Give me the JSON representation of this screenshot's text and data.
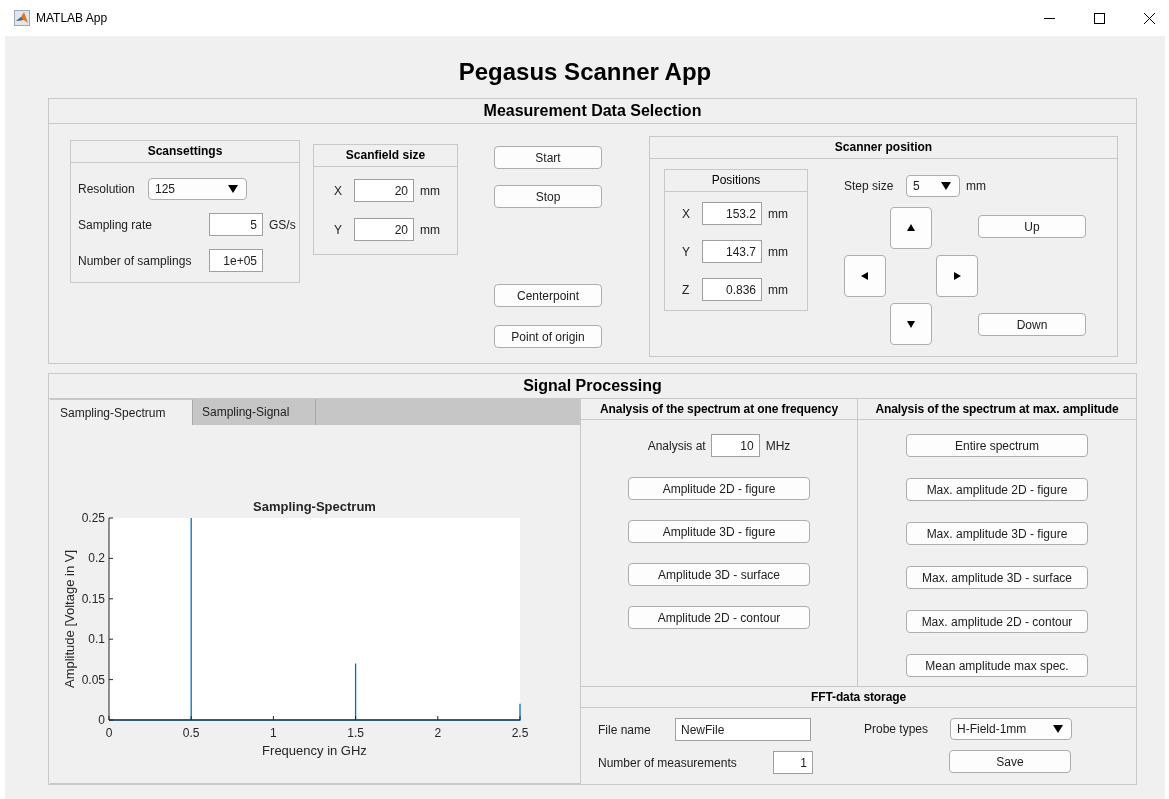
{
  "window": {
    "title": "MATLAB App"
  },
  "app_title": "Pegasus Scanner App",
  "measurement": {
    "title": "Measurement Data Selection",
    "scansettings": {
      "title": "Scansettings",
      "resolution": {
        "label": "Resolution",
        "value": "125"
      },
      "sampling_rate": {
        "label": "Sampling rate",
        "value": "5",
        "unit": "GS/s"
      },
      "samplings": {
        "label": "Number of samplings",
        "value": "1e+05"
      }
    },
    "scanfield": {
      "title": "Scanfield size",
      "fields": [
        {
          "label": "X",
          "value": "20",
          "unit": "mm"
        },
        {
          "label": "Y",
          "value": "20",
          "unit": "mm"
        }
      ]
    },
    "run_buttons": [
      "Start",
      "Stop"
    ],
    "position_buttons": [
      "Centerpoint",
      "Point of origin"
    ],
    "scanner": {
      "title": "Scanner position",
      "positions": {
        "title": "Positions",
        "fields": [
          {
            "label": "X",
            "value": "153.2",
            "unit": "mm"
          },
          {
            "label": "Y",
            "value": "143.7",
            "unit": "mm"
          },
          {
            "label": "Z",
            "value": "0.836",
            "unit": "mm"
          }
        ]
      },
      "step": {
        "label": "Step size",
        "value": "5",
        "unit": "mm"
      },
      "up": "Up",
      "down": "Down"
    }
  },
  "signal": {
    "title": "Signal Processing",
    "tabs": [
      {
        "label": "Sampling-Spectrum",
        "selected": true
      },
      {
        "label": "Sampling-Signal",
        "selected": false
      }
    ],
    "chart_data": {
      "type": "line",
      "title": "Sampling-Spectrum",
      "xlabel": "Frequency in GHz",
      "ylabel": "Amplitude [Voltage in V]",
      "x": [
        0,
        0.5,
        0.5,
        0.5,
        1.5,
        1.5,
        1.5,
        2.5,
        2.5
      ],
      "series": [
        {
          "color": "#0072bd",
          "values": [
            0,
            0,
            0.25,
            0,
            0,
            0.07,
            0,
            0,
            0.02
          ]
        }
      ],
      "xlim": [
        0,
        2.5
      ],
      "ylim": [
        0,
        0.25
      ],
      "xticks": [
        0,
        0.5,
        1,
        1.5,
        2,
        2.5
      ],
      "yticks": [
        0,
        0.05,
        0.1,
        0.15,
        0.2,
        0.25
      ]
    },
    "single": {
      "title": "Analysis of the spectrum at one frequency",
      "analysis": {
        "label": "Analysis at",
        "value": "10",
        "unit": "MHz"
      },
      "buttons": [
        "Amplitude 2D - figure",
        "Amplitude 3D - figure",
        "Amplitude 3D - surface",
        "Amplitude 2D - contour"
      ]
    },
    "max": {
      "title": "Analysis of the spectrum at max. amplitude",
      "buttons": [
        "Entire spectrum",
        "Max. amplitude 2D - figure",
        "Max. amplitude 3D - figure",
        "Max. amplitude 3D - surface",
        "Max. amplitude 2D - contour",
        "Mean amplitude max spec."
      ]
    },
    "storage": {
      "title": "FFT-data storage",
      "file": {
        "label": "File name",
        "value": "NewFile"
      },
      "count": {
        "label": "Number of measurements",
        "value": "1"
      },
      "probe": {
        "label": "Probe types",
        "value": "H-Field-1mm"
      },
      "save": "Save"
    }
  }
}
